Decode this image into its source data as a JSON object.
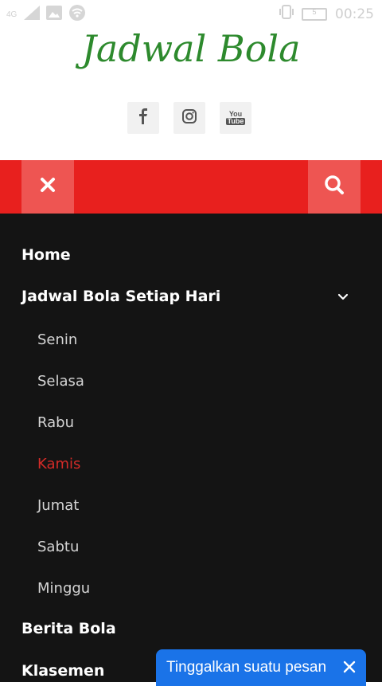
{
  "status_bar": {
    "sim_label": "4G",
    "battery_level": "5",
    "time": "00:25"
  },
  "header": {
    "site_title": "Jadwal Bola",
    "title_color": "#2d8a2d",
    "social_icons": [
      "facebook-icon",
      "instagram-icon",
      "youtube-icon"
    ],
    "youtube_text_top": "You",
    "youtube_text_bottom": "Tube"
  },
  "toolbar": {
    "bar_color": "#e8201e",
    "close_icon": "close-icon",
    "search_icon": "search-icon"
  },
  "menu": {
    "items": [
      {
        "label": "Home"
      },
      {
        "label": "Jadwal Bola Setiap Hari",
        "expanded": true
      },
      {
        "label": "Berita Bola"
      },
      {
        "label": "Klasemen"
      }
    ],
    "subitems": [
      {
        "label": "Senin"
      },
      {
        "label": "Selasa"
      },
      {
        "label": "Rabu"
      },
      {
        "label": "Kamis",
        "active": true
      },
      {
        "label": "Jumat"
      },
      {
        "label": "Sabtu"
      },
      {
        "label": "Minggu"
      }
    ],
    "active_color": "#d42b28"
  },
  "chat_widget": {
    "label": "Tinggalkan suatu pesan",
    "color": "#1a73e8"
  }
}
